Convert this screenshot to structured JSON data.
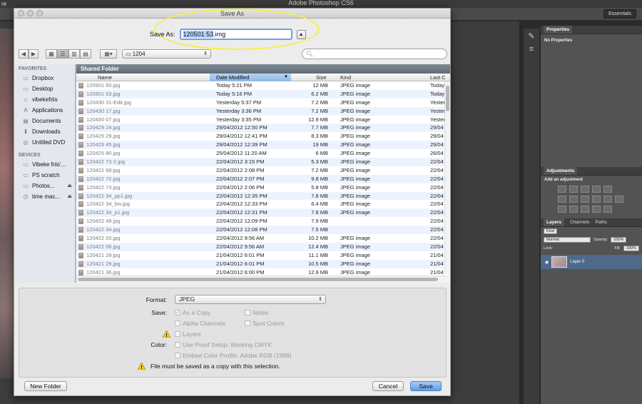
{
  "app": {
    "title": "Adobe Photoshop CS6",
    "left_menu": "re",
    "workspace_button": "Essentials"
  },
  "panels": {
    "properties_tab": "Properties",
    "properties_sub": "No Properties",
    "adjustments_tab": "Adjustments",
    "adjustments_sub": "Add an adjustment",
    "layers_tabs": [
      "Layers",
      "Channels",
      "Paths"
    ],
    "kind_filter": "Kind",
    "blend_mode": "Normal",
    "opacity_label": "Opacity:",
    "opacity_value": "100%",
    "lock_label": "Lock:",
    "fill_label": "Fill:",
    "fill_value": "100%",
    "layer_name": "Layer 0"
  },
  "dialog": {
    "title": "Save As",
    "saveas_label": "Save As:",
    "filename": "120501 53.img",
    "filename_selected": "120501 53",
    "filename_ext": ".img",
    "current_folder": "1204",
    "sidebar": {
      "favorites_header": "FAVORITES",
      "favorites": [
        "Dropbox",
        "Desktop",
        "vibekefriis",
        "Applications",
        "Documents",
        "Downloads",
        "Untitled DVD"
      ],
      "devices_header": "DEVICES",
      "devices": [
        "Vibeke friis'...",
        "PS scratch",
        "Photos...",
        "time mac..."
      ]
    },
    "list": {
      "section": "Shared Folder",
      "columns": [
        "Name",
        "Date Modified",
        "Size",
        "Kind",
        "Last C"
      ],
      "rows": [
        [
          "120501 60.jpg",
          "Today 5:21 PM",
          "12 MB",
          "JPEG image",
          "Today"
        ],
        [
          "120501 53.jpg",
          "Today 5:16 PM",
          "6.2 MB",
          "JPEG image",
          "Today"
        ],
        [
          "120430 31-Edit.jpg",
          "Yesterday 5:37 PM",
          "7.2 MB",
          "JPEG image",
          "Yester"
        ],
        [
          "120430 17.jpg",
          "Yesterday 3:36 PM",
          "7.2 MB",
          "JPEG image",
          "Yester"
        ],
        [
          "120430 07.jpg",
          "Yesterday 3:35 PM",
          "12.9 MB",
          "JPEG image",
          "Yester"
        ],
        [
          "120429 24.jpg",
          "29/04/2012 12:50 PM",
          "7.7 MB",
          "JPEG image",
          "29/04"
        ],
        [
          "120429 29.jpg",
          "29/04/2012 12:41 PM",
          "8.3 MB",
          "JPEG image",
          "29/04"
        ],
        [
          "120429 45.jpg",
          "29/04/2012 12:39 PM",
          "19 MB",
          "JPEG image",
          "29/04"
        ],
        [
          "120425 80.jpg",
          "25/04/2012 11:20 AM",
          "6 MB",
          "JPEG image",
          "26/04"
        ],
        [
          "120422 73-2.jpg",
          "22/04/2012 3:15 PM",
          "5.3 MB",
          "JPEG image",
          "22/04"
        ],
        [
          "120422 68.jpg",
          "22/04/2012 2:08 PM",
          "7.2 MB",
          "JPEG image",
          "22/04"
        ],
        [
          "120422 72.jpg",
          "22/04/2012 2:07 PM",
          "9.8 MB",
          "JPEG image",
          "22/04"
        ],
        [
          "120422 73.jpg",
          "22/04/2012 2:06 PM",
          "5.8 MB",
          "JPEG image",
          "22/04"
        ],
        [
          "120422 34_pp1.jpg",
          "22/04/2012 12:35 PM",
          "7.8 MB",
          "JPEG image",
          "22/04"
        ],
        [
          "120422 34_bw.jpg",
          "22/04/2012 12:33 PM",
          "6.4 MB",
          "JPEG image",
          "22/04"
        ],
        [
          "120422 34_p1.jpg",
          "22/04/2012 12:31 PM",
          "7.8 MB",
          "JPEG image",
          "22/04"
        ],
        [
          "120422 49.jpg",
          "22/04/2012 12:09 PM",
          "7.9 MB",
          "",
          "22/04"
        ],
        [
          "120422 34.jpg",
          "22/04/2012 12:08 PM",
          "7.5 MB",
          "",
          "22/04"
        ],
        [
          "120422 20.jpg",
          "22/04/2012 9:56 AM",
          "10.2 MB",
          "JPEG image",
          "22/04"
        ],
        [
          "120422 06.jpg",
          "22/04/2012 9:56 AM",
          "12.4 MB",
          "JPEG image",
          "22/04"
        ],
        [
          "120421 28.jpg",
          "21/04/2012 6:01 PM",
          "11.1 MB",
          "JPEG image",
          "21/04"
        ],
        [
          "120421 29.jpg",
          "21/04/2012 6:01 PM",
          "10.5 MB",
          "JPEG image",
          "21/04"
        ],
        [
          "120421 36.jpg",
          "21/04/2012 6:00 PM",
          "12.9 MB",
          "JPEG image",
          "21/04"
        ]
      ]
    },
    "options": {
      "format_label": "Format:",
      "format_value": "JPEG",
      "save_label": "Save:",
      "as_a_copy": "As a Copy",
      "notes": "Notes",
      "alpha_channels": "Alpha Channels",
      "spot_colors": "Spot Colors",
      "layers": "Layers",
      "color_label": "Color:",
      "use_proof": "Use Proof Setup:  Working CMYK",
      "embed_profile": "Embed Color Profile:  Adobe RGB (1998)",
      "warning_text": "File must be saved as a copy with this selection."
    },
    "buttons": {
      "new_folder": "New Folder",
      "cancel": "Cancel",
      "save": "Save"
    }
  }
}
